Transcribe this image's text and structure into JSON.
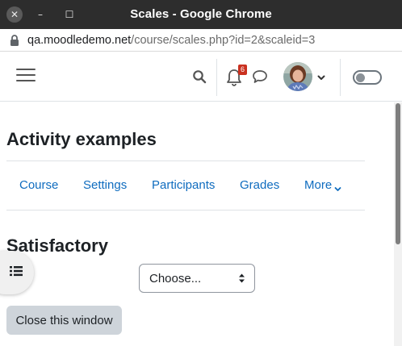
{
  "window": {
    "title": "Scales - Google Chrome",
    "close_glyph": "✕",
    "minimize_glyph": "–",
    "maximize_glyph": "☐"
  },
  "address_bar": {
    "domain": "qa.moodledemo.net",
    "path": "/course/scales.php?id=2&scaleid=3",
    "icon": "lock-icon"
  },
  "navbar": {
    "menu_icon": "hamburger-menu-icon",
    "search_icon": "search-icon",
    "notifications_icon": "bell-icon",
    "notifications_count": "6",
    "messages_icon": "chat-bubble-icon",
    "user_menu_icon": "chevron-down-icon",
    "mode_toggle": "edit-mode-toggle",
    "badge_color": "#ca3120"
  },
  "page": {
    "heading": "Activity examples",
    "secondary_nav": {
      "items": [
        "Course",
        "Settings",
        "Participants",
        "Grades",
        "More"
      ],
      "link_color": "#0f6cbf"
    },
    "scale": {
      "heading": "Satisfactory",
      "select_value": "Choose..."
    },
    "close_button_label": "Close this window",
    "index_drawer_icon": "list-icon"
  }
}
